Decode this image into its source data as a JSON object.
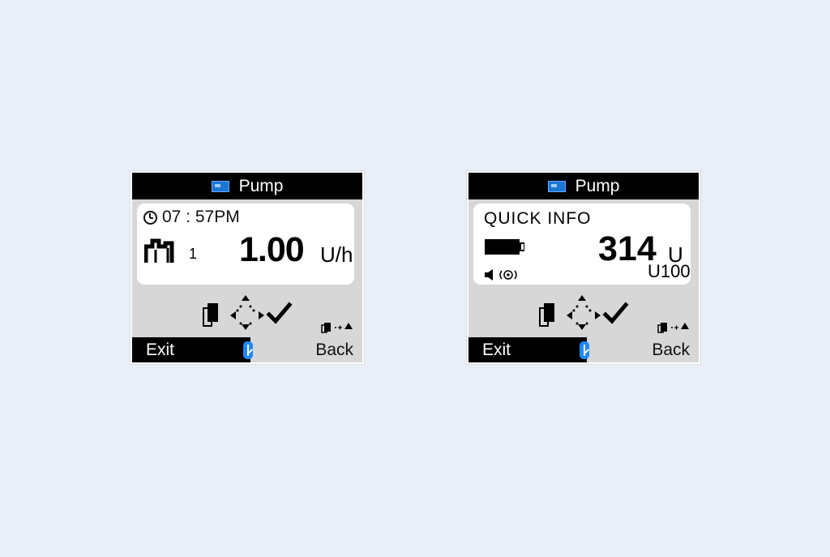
{
  "screens": [
    {
      "title": "Pump",
      "clock": "07 : 57PM",
      "basal_profile": "1",
      "rate_value": "1.00",
      "rate_unit": "U/h",
      "left_soft_key": "Exit",
      "right_soft_key": "Back"
    },
    {
      "title": "Pump",
      "quick_info_title": "QUICK INFO",
      "insulin_units": "314",
      "insulin_unit": "U",
      "cartridge_type": "U100",
      "left_soft_key": "Exit",
      "right_soft_key": "Back"
    }
  ],
  "colors": {
    "background": "#e9eff7",
    "screen_black": "#000000",
    "panel_gray": "#d7d7d7",
    "bluetooth_blue": "#1f88ff",
    "pump_icon_blue": "#1976d2"
  },
  "icons": [
    "pump-icon",
    "clock-icon",
    "basal-profile-icon",
    "battery-icon",
    "sound-icon",
    "vibration-icon",
    "navigation-arrows-icon",
    "checkmark-icon",
    "bluetooth-icon"
  ]
}
